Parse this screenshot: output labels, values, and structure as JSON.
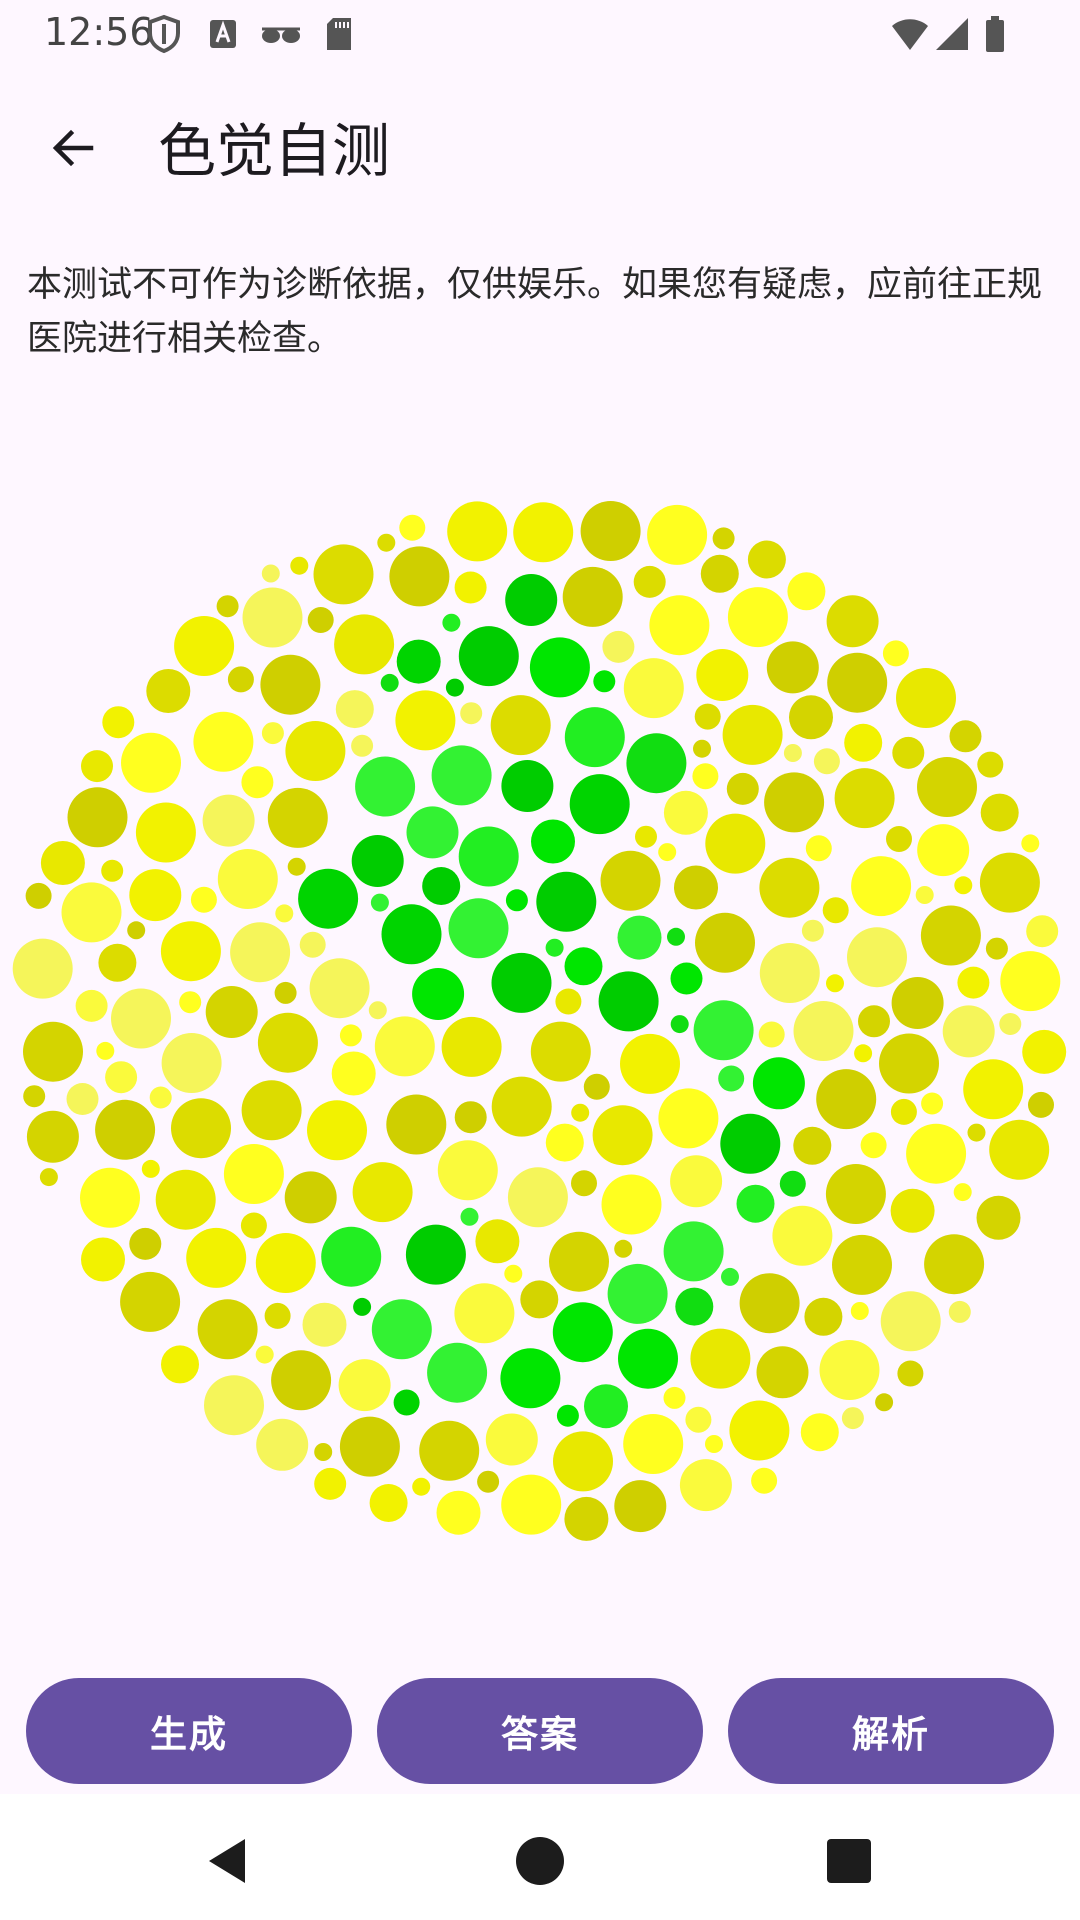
{
  "status_bar": {
    "time": "12:56",
    "left_icons": [
      "vpn-shield-icon",
      "keyboard-a-icon",
      "glasses-icon",
      "sd-card-icon"
    ],
    "right_icons": [
      "wifi-icon",
      "cellular-signal-icon",
      "battery-icon"
    ]
  },
  "app_bar": {
    "back_icon": "arrow-left-icon",
    "title": "色觉自测"
  },
  "disclaimer": "本测试不可作为诊断依据，仅供娱乐。如果您有疑虑，应前往正规医院进行相关检查。",
  "plate": {
    "palette": {
      "background_dots": [
        "#ffff1f",
        "#f2f200",
        "#e8e800",
        "#dcdc00",
        "#cfcf00",
        "#f5f55a",
        "#fafa3c",
        "#d4d400"
      ],
      "figure_dots": [
        "#00e600",
        "#00cc00",
        "#22ee22",
        "#33f233",
        "#00d400",
        "#11dd11"
      ]
    }
  },
  "actions": {
    "generate_label": "生成",
    "answer_label": "答案",
    "explain_label": "解析"
  },
  "colors": {
    "background": "#fef7ff",
    "primary": "#6650a4",
    "on_primary": "#ffffff",
    "title_text": "#1d1b20",
    "nav_bar": "#ffffff",
    "nav_icon": "#1c1c1c"
  },
  "nav_bar": {
    "icons": [
      "back-triangle-icon",
      "home-circle-icon",
      "recents-square-icon"
    ]
  }
}
